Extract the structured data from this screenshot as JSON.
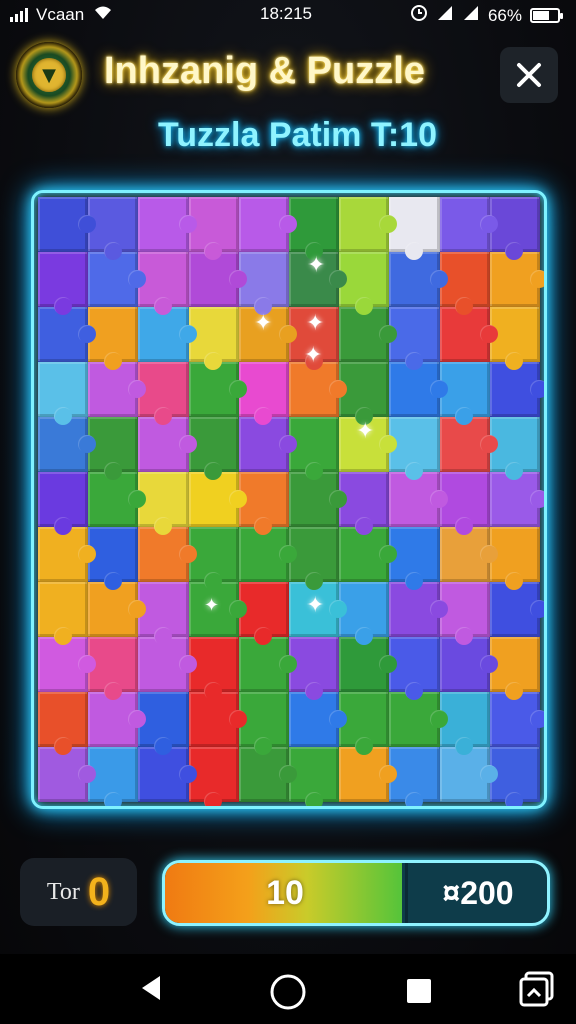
{
  "status_bar": {
    "carrier": "Vcaan",
    "time": "18:215",
    "battery": "66%",
    "battery_level": 0.66,
    "icons": [
      "signal-icon",
      "wifi-icon",
      "alarm-icon",
      "network-icon",
      "battery-icon"
    ]
  },
  "header": {
    "title": "Inhzanig & Puzzle",
    "subtitle": "Tuzzla Patim T:10",
    "badge_icon": "emblem-icon",
    "close_icon": "close-icon"
  },
  "board": {
    "columns": 10,
    "rows": 11,
    "colors": [
      [
        "#3f4fd8",
        "#5a5ae0",
        "#b85ae8",
        "#c85ad8",
        "#b85ae8",
        "#2f9a3a",
        "#a8d83a",
        "#e8e8f0",
        "#7a5ae8",
        "#6a48d8"
      ],
      [
        "#7a3ae0",
        "#4f6ae8",
        "#c85ad8",
        "#b04ad8",
        "#8a7ae8",
        "#3a8a4a",
        "#9ad83a",
        "#3f6ae0",
        "#e8502a",
        "#f0a020"
      ],
      [
        "#3f5fe0",
        "#f0a020",
        "#3fa8e8",
        "#e8d83a",
        "#e8a020",
        "#e04a3a",
        "#3a9a3a",
        "#4a6ae8",
        "#e83a3a",
        "#f0b020"
      ],
      [
        "#5ac0e8",
        "#c05ae0",
        "#e84a8a",
        "#3aa83a",
        "#e84ad0",
        "#f07a2a",
        "#3a9a3a",
        "#2f7ae8",
        "#3aa0e8",
        "#3f4fe0"
      ],
      [
        "#3a7ad8",
        "#3a9a3a",
        "#c05ae0",
        "#3a9a3a",
        "#8a4ae0",
        "#3aa83a",
        "#c8e03a",
        "#5ac0e8",
        "#e84a4a",
        "#4ab8e0"
      ],
      [
        "#6a3ae0",
        "#3aa83a",
        "#e8d83a",
        "#f0d020",
        "#f07a2a",
        "#3a9a3a",
        "#8a4ae0",
        "#c05ae0",
        "#b04ae0",
        "#9a5ae8"
      ],
      [
        "#f0b020",
        "#2f5fe0",
        "#f07a2a",
        "#3aa83a",
        "#3aa83a",
        "#3a9a3a",
        "#3aa83a",
        "#2f7ae8",
        "#e8a03a",
        "#f0a020"
      ],
      [
        "#f0b020",
        "#f0a020",
        "#c05ae0",
        "#3aa83a",
        "#e82a2a",
        "#3ac0d8",
        "#3aa0e8",
        "#8a4ae0",
        "#c05ae0",
        "#3f4fe0"
      ],
      [
        "#d05ae0",
        "#e84a8a",
        "#c05ae0",
        "#e82a2a",
        "#3aa83a",
        "#8a4ae0",
        "#2f9a3a",
        "#4a5ae8",
        "#6a4ae0",
        "#f0a020"
      ],
      [
        "#e8502a",
        "#c05ae0",
        "#2f5fe0",
        "#e82a2a",
        "#3aa83a",
        "#2f7ae8",
        "#3aa83a",
        "#3aa83a",
        "#3ab0d8",
        "#4a5ae8"
      ],
      [
        "#a05ae0",
        "#3a9ae8",
        "#3f4fe0",
        "#e82a2a",
        "#3a9a3a",
        "#3aa83a",
        "#f0a020",
        "#3a8ae8",
        "#5ab0e8",
        "#3f5fe0"
      ]
    ]
  },
  "footer": {
    "score_label": "Tor",
    "score_value": "0",
    "progress_value": "10",
    "progress_target": "¤200",
    "progress_fraction": 0.62
  },
  "nav_bar": {
    "icons": [
      "back-icon",
      "home-icon",
      "recents-icon",
      "screenshot-icon"
    ]
  }
}
